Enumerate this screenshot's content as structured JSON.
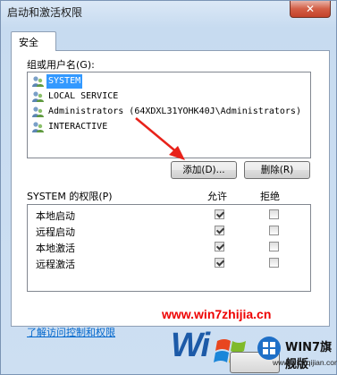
{
  "window": {
    "title": "启动和激活权限",
    "close_glyph": "✕"
  },
  "tabs": [
    {
      "label": "安全"
    }
  ],
  "users_group": {
    "label": "组或用户名(G):",
    "items": [
      {
        "name": "SYSTEM",
        "selected": true
      },
      {
        "name": "LOCAL SERVICE",
        "selected": false
      },
      {
        "name": "Administrators (64XDXL31YOHK40J\\Administrators)",
        "selected": false
      },
      {
        "name": "INTERACTIVE",
        "selected": false
      }
    ],
    "add_button": "添加(D)...",
    "remove_button": "删除(R)"
  },
  "permissions": {
    "label": "SYSTEM 的权限(P)",
    "allow_header": "允许",
    "deny_header": "拒绝",
    "rows": [
      {
        "name": "本地启动",
        "allow": true,
        "deny": false
      },
      {
        "name": "远程启动",
        "allow": true,
        "deny": false
      },
      {
        "name": "本地激活",
        "allow": true,
        "deny": false
      },
      {
        "name": "远程激活",
        "allow": true,
        "deny": false
      }
    ]
  },
  "help_link": "了解访问控制和权限",
  "watermark": "www.win7zhijia.cn",
  "branding": {
    "logo_text": "Wi",
    "title": "WIN7旗舰版",
    "url": "www.win7qijian.com"
  },
  "colors": {
    "selection": "#3399ff",
    "link": "#0066cc",
    "watermark": "#ee0000"
  }
}
